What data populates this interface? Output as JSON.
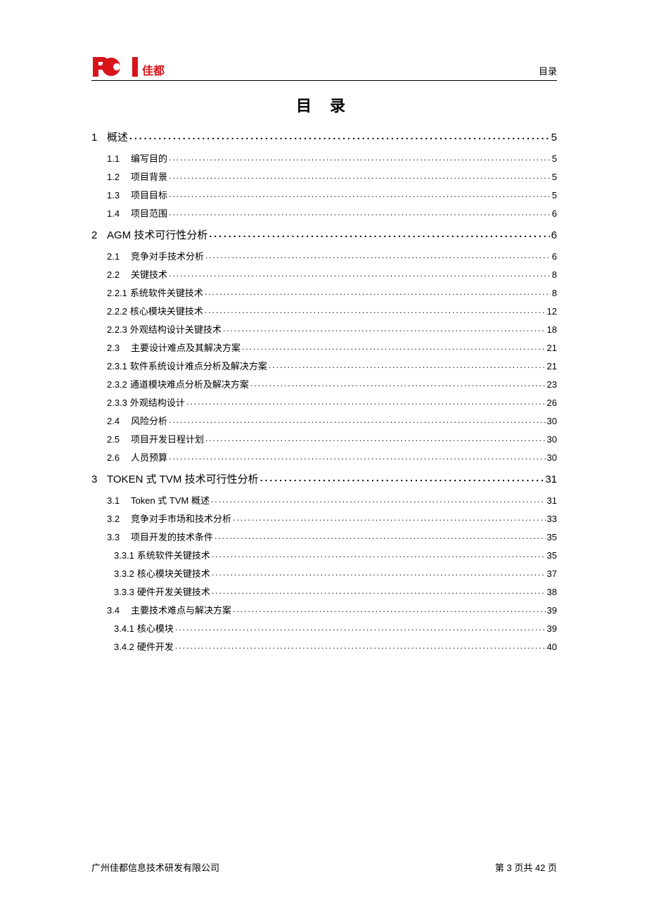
{
  "header": {
    "header_right": "目录"
  },
  "title": "目 录",
  "toc": [
    {
      "level": "l1",
      "num": "1",
      "text": "概述",
      "page": "5"
    },
    {
      "level": "l2",
      "num": "1.1",
      "text": "编写目的",
      "page": "5"
    },
    {
      "level": "l2",
      "num": "1.2",
      "text": "项目背景",
      "page": "5"
    },
    {
      "level": "l2",
      "num": "1.3",
      "text": "项目目标",
      "page": "5"
    },
    {
      "level": "l2",
      "num": "1.4",
      "text": "项目范围",
      "page": "6"
    },
    {
      "level": "l1",
      "num": "2",
      "text": "AGM 技术可行性分析",
      "page": "6"
    },
    {
      "level": "l2",
      "num": "2.1",
      "text": "竞争对手技术分析",
      "page": "6"
    },
    {
      "level": "l2",
      "num": "2.2",
      "text": "关键技术",
      "page": "8"
    },
    {
      "level": "l3",
      "num": "2.2.1",
      "text": "系统软件关键技术",
      "page": "8"
    },
    {
      "level": "l3",
      "num": "2.2.2",
      "text": "核心模块关键技术",
      "page": "12"
    },
    {
      "level": "l3",
      "num": "2.2.3",
      "text": "外观结构设计关键技术",
      "page": "18"
    },
    {
      "level": "l2",
      "num": "2.3",
      "text": "主要设计难点及其解决方案",
      "page": "21"
    },
    {
      "level": "l3",
      "num": "2.3.1",
      "text": "软件系统设计难点分析及解决方案",
      "page": "21"
    },
    {
      "level": "l3",
      "num": "2.3.2",
      "text": "通道模块难点分析及解决方案",
      "page": "23"
    },
    {
      "level": "l3",
      "num": "2.3.3",
      "text": "外观结构设计",
      "page": "26"
    },
    {
      "level": "l2",
      "num": "2.4",
      "text": "风险分析",
      "page": "30"
    },
    {
      "level": "l2",
      "num": "2.5",
      "text": "项目开发日程计划",
      "page": "30"
    },
    {
      "level": "l2",
      "num": "2.6",
      "text": "人员预算",
      "page": "30"
    },
    {
      "level": "l1",
      "num": "3",
      "text": "TOKEN 式 TVM 技术可行性分析",
      "page": "31"
    },
    {
      "level": "l2",
      "num": "3.1",
      "text": "Token 式 TVM 概述",
      "page": "31"
    },
    {
      "level": "l2",
      "num": "3.2",
      "text": "竞争对手市场和技术分析",
      "page": "33"
    },
    {
      "level": "l2",
      "num": "3.3",
      "text": "项目开发的技术条件",
      "page": "35"
    },
    {
      "level": "l3b",
      "num": "3.3.1",
      "text": "系统软件关键技术",
      "page": "35"
    },
    {
      "level": "l3b",
      "num": "3.3.2",
      "text": "核心模块关键技术",
      "page": "37"
    },
    {
      "level": "l3b",
      "num": "3.3.3",
      "text": "硬件开发关键技术",
      "page": "38"
    },
    {
      "level": "l2",
      "num": "3.4",
      "text": "主要技术难点与解决方案",
      "page": "39"
    },
    {
      "level": "l3b",
      "num": "3.4.1",
      "text": "核心模块",
      "page": "39"
    },
    {
      "level": "l3b",
      "num": "3.4.2",
      "text": "硬件开发",
      "page": "40"
    }
  ],
  "footer": {
    "company": "广州佳都信息技术研发有限公司",
    "page_info": "第 3 页共 42 页"
  }
}
